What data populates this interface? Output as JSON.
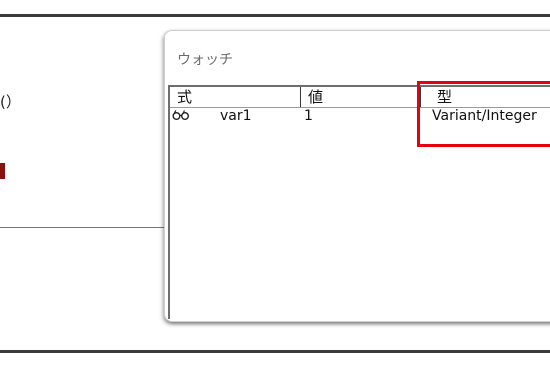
{
  "background": {
    "paren_text": "(）",
    "accent_color": "#8b1010"
  },
  "watch_window": {
    "title": "ウォッチ",
    "columns": [
      "式",
      "値",
      "型"
    ],
    "rows": [
      {
        "icon": "watch-glasses-icon",
        "expression": "var1",
        "value": "1",
        "type": "Variant/Integer"
      }
    ]
  },
  "highlight": {
    "color": "#e60012"
  }
}
